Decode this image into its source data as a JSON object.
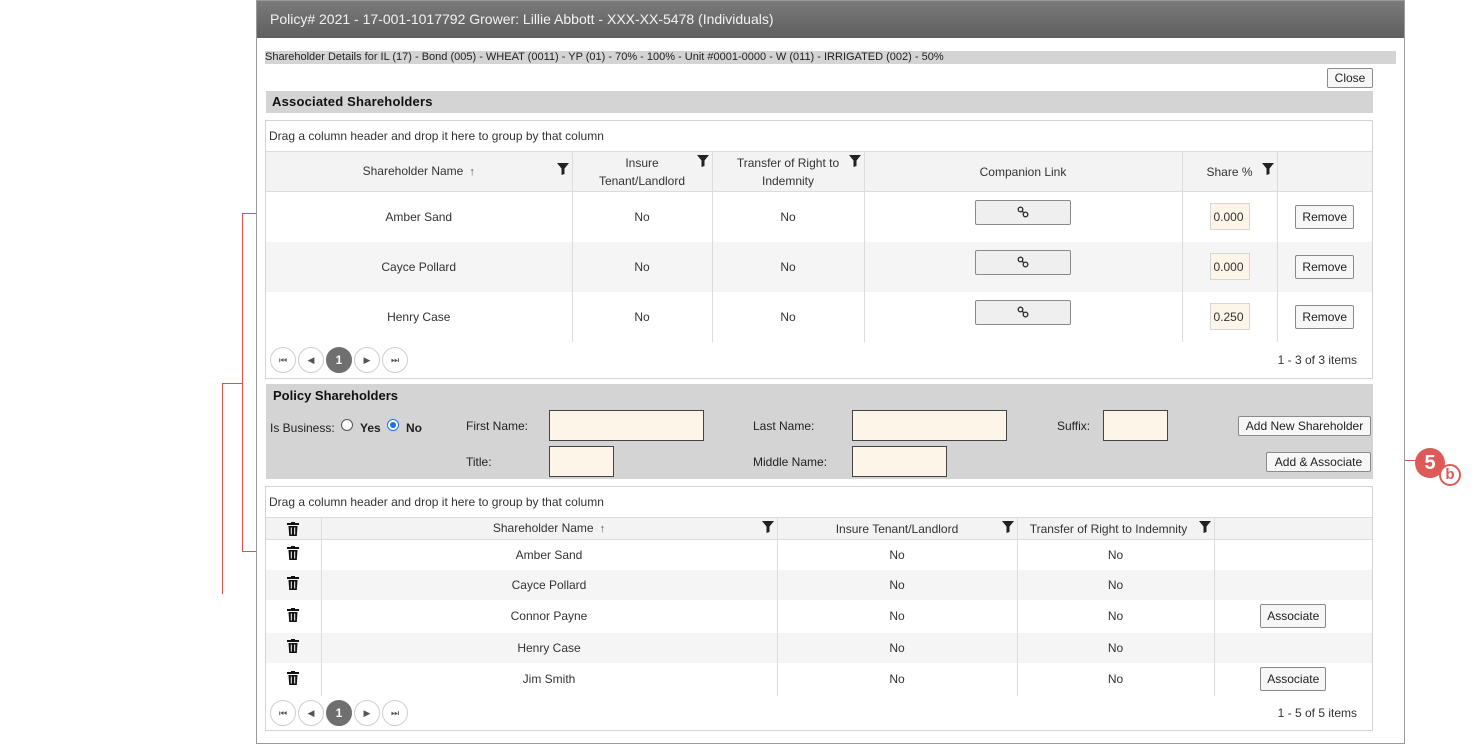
{
  "dialog": {
    "title": "Policy# 2021 - 17-001-1017792 Grower: Lillie Abbott - XXX-XX-5478 (Individuals)",
    "details": "Shareholder Details for IL (17) - Bond (005) - WHEAT (0011) - YP (01) - 70% - 100% - Unit #0001-0000 - W (011) - IRRIGATED (002) - 50%",
    "close_label": "Close"
  },
  "associated": {
    "title": "Associated Shareholders",
    "group_hint": "Drag a column header and drop it here to group by that column",
    "columns": {
      "name": "Shareholder Name",
      "insure": "Insure Tenant/Landlord",
      "transfer": "Transfer of Right to Indemnity",
      "companion": "Companion Link",
      "share": "Share %"
    },
    "rows": [
      {
        "name": "Amber Sand",
        "insure": "No",
        "transfer": "No",
        "share": "0.000",
        "remove": "Remove"
      },
      {
        "name": "Cayce Pollard",
        "insure": "No",
        "transfer": "No",
        "share": "0.000",
        "remove": "Remove"
      },
      {
        "name": "Henry Case",
        "insure": "No",
        "transfer": "No",
        "share": "0.250",
        "remove": "Remove"
      }
    ],
    "pager": {
      "current_page": "1",
      "info": "1 - 3 of 3 items"
    }
  },
  "policy": {
    "title": "Policy Shareholders",
    "is_business_label": "Is Business:",
    "yes_label": "Yes",
    "no_label": "No",
    "is_business_value": "No",
    "first_name_label": "First Name:",
    "last_name_label": "Last Name:",
    "suffix_label": "Suffix:",
    "title_label": "Title:",
    "middle_name_label": "Middle Name:",
    "first_name_value": "",
    "last_name_value": "",
    "suffix_value": "",
    "title_value": "",
    "middle_name_value": "",
    "add_new_label": "Add New Shareholder",
    "add_associate_label": "Add & Associate"
  },
  "policy_grid": {
    "group_hint": "Drag a column header and drop it here to group by that column",
    "columns": {
      "name": "Shareholder Name",
      "insure": "Insure Tenant/Landlord",
      "transfer": "Transfer of Right to Indemnity"
    },
    "rows": [
      {
        "name": "Amber Sand",
        "insure": "No",
        "transfer": "No",
        "action": ""
      },
      {
        "name": "Cayce Pollard",
        "insure": "No",
        "transfer": "No",
        "action": ""
      },
      {
        "name": "Connor Payne",
        "insure": "No",
        "transfer": "No",
        "action": "Associate"
      },
      {
        "name": "Henry Case",
        "insure": "No",
        "transfer": "No",
        "action": ""
      },
      {
        "name": "Jim Smith",
        "insure": "No",
        "transfer": "No",
        "action": "Associate"
      }
    ],
    "pager": {
      "current_page": "1",
      "info": "1 - 5 of 5 items"
    }
  },
  "annotation": {
    "step": "5",
    "sub": "b"
  },
  "colors": {
    "accent": "#1a73e8",
    "annotation": "#de5a58",
    "input_bg": "#fdf5e8"
  },
  "icons": {
    "filter": "filter-icon",
    "trash": "trash-icon",
    "link": "link-icon",
    "sort": "sort-up-icon"
  }
}
